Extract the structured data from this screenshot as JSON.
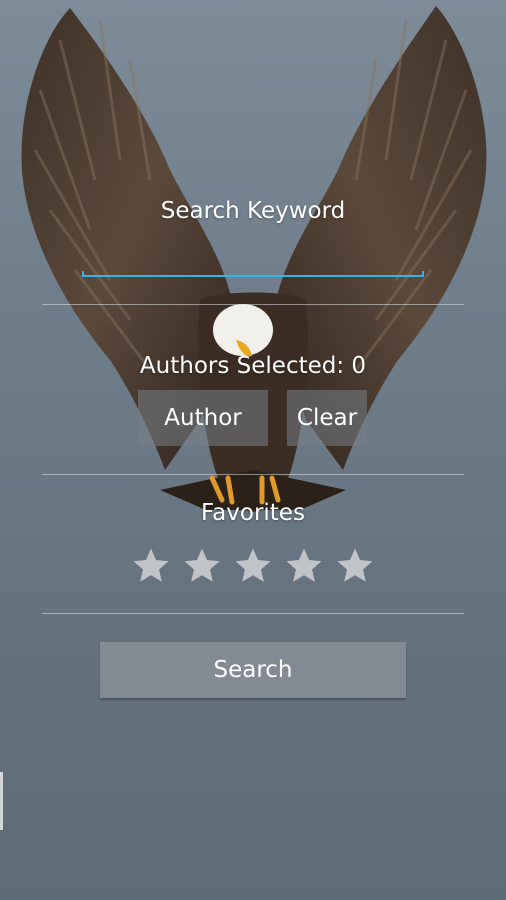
{
  "search": {
    "label": "Search Keyword",
    "value": "",
    "placeholder": ""
  },
  "authors": {
    "selected_label": "Authors Selected: 0",
    "author_button": "Author",
    "clear_button": "Clear"
  },
  "favorites": {
    "label": "Favorites",
    "rating": 0,
    "max_rating": 5,
    "star_color": "#c0c4c8"
  },
  "actions": {
    "search_button": "Search"
  },
  "colors": {
    "accent": "#33b5e5",
    "background": "#6f7d8a",
    "button": "#7a838c"
  },
  "background_image": "eagle-illustration"
}
